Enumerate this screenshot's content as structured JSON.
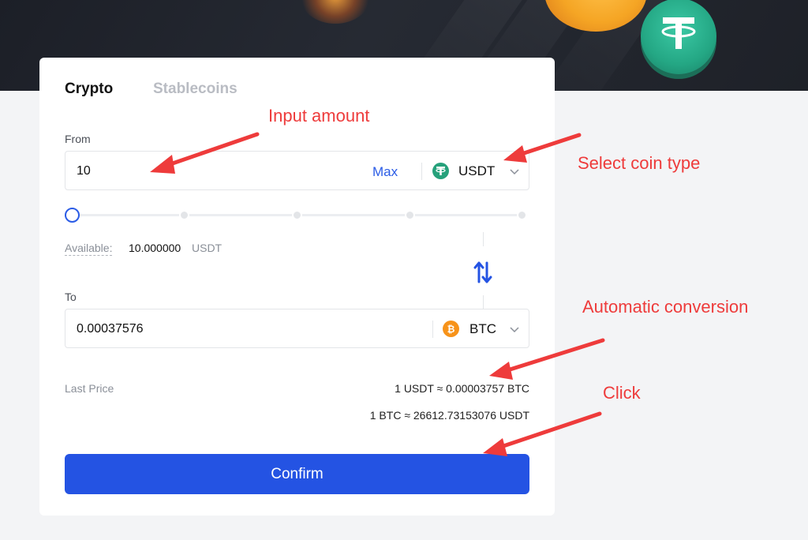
{
  "tabs": [
    {
      "label": "Crypto",
      "active": true
    },
    {
      "label": "Stablecoins",
      "active": false
    }
  ],
  "from": {
    "label": "From",
    "amount": "10",
    "max_label": "Max",
    "coin": {
      "symbol": "USDT",
      "icon": "tether-icon",
      "color": "#26a17b"
    }
  },
  "slider": {
    "percent": 0,
    "stops": [
      0,
      25,
      50,
      75,
      100
    ]
  },
  "available": {
    "label": "Available",
    "separator": ":",
    "value": "10.000000",
    "unit": "USDT"
  },
  "to": {
    "label": "To",
    "amount": "0.00037576",
    "coin": {
      "symbol": "BTC",
      "icon": "bitcoin-icon",
      "color": "#f7931a"
    }
  },
  "last_price": {
    "label": "Last Price",
    "lines": [
      "1 USDT ≈ 0.00003757 BTC",
      "1 BTC ≈ 26612.73153076 USDT"
    ]
  },
  "confirm_label": "Confirm",
  "annotations": {
    "input_amount": "Input amount",
    "select_coin": "Select coin type",
    "auto_conversion": "Automatic conversion",
    "click": "Click"
  },
  "colors": {
    "accent": "#2453e3",
    "annotation": "#ee3b3b"
  }
}
